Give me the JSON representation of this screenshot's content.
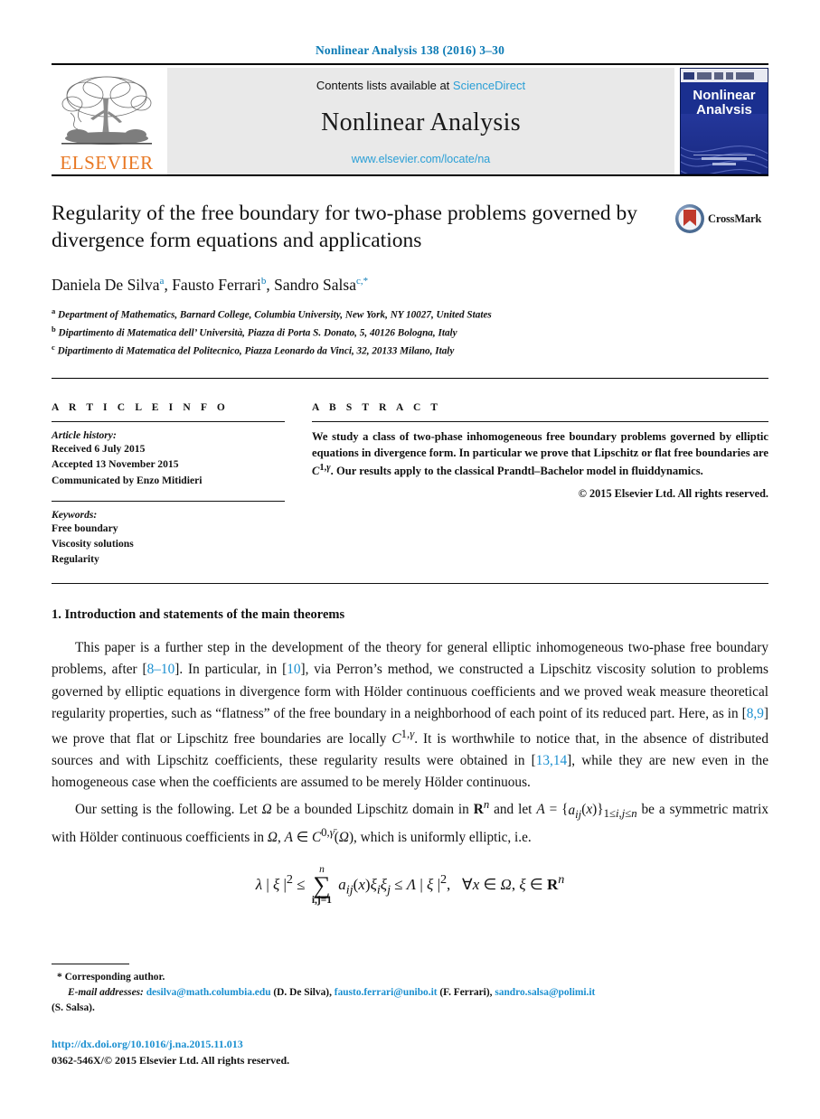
{
  "running_head": "Nonlinear Analysis 138 (2016) 3–30",
  "masthead": {
    "contents_prefix": "Contents lists available at ",
    "sciencedirect": "ScienceDirect",
    "journal_name": "Nonlinear Analysis",
    "journal_url": "www.elsevier.com/locate/na",
    "publisher_word": "ELSEVIER",
    "cover_title_line1": "Nonlinear",
    "cover_title_line2": "Analysis"
  },
  "article": {
    "title": "Regularity of the free boundary for two-phase problems governed by divergence form equations and applications",
    "crossmark_label": "CrossMark",
    "authors_html": "Daniela De Silva<sup>a</sup>, Fausto Ferrari<sup>b</sup>, Sandro Salsa<sup>c,*</sup>",
    "affiliations": [
      {
        "marker": "a",
        "text": "Department of Mathematics, Barnard College, Columbia University, New York, NY 10027, United States"
      },
      {
        "marker": "b",
        "text": "Dipartimento di Matematica dell’ Università, Piazza di Porta S. Donato, 5, 40126 Bologna, Italy"
      },
      {
        "marker": "c",
        "text": "Dipartimento di Matematica del Politecnico, Piazza Leonardo da Vinci, 32, 20133 Milano, Italy"
      }
    ]
  },
  "article_info": {
    "heading": "A R T I C L E    I N F O",
    "history_label": "Article history:",
    "history": [
      "Received 6 July 2015",
      "Accepted 13 November 2015",
      "Communicated by Enzo Mitidieri"
    ],
    "keywords_label": "Keywords:",
    "keywords": [
      "Free boundary",
      "Viscosity solutions",
      "Regularity"
    ]
  },
  "abstract": {
    "heading": "A B S T R A C T",
    "text": "We study a class of two-phase inhomogeneous free boundary problems governed by elliptic equations in divergence form. In particular we prove that Lipschitz or flat free boundaries are C1,γ. Our results apply to the classical Prandtl–Bachelor model in fluiddynamics.",
    "copyright": "© 2015 Elsevier Ltd. All rights reserved."
  },
  "body": {
    "section_heading": "1. Introduction and statements of the main theorems",
    "paragraph1_parts": {
      "p1": "This paper is a further step in the development of the theory for general elliptic inhomogeneous two-phase free boundary problems, after ",
      "ref1": "8–10",
      "p2": ". In particular, in ",
      "ref2": "10",
      "p3": ", via Perron’s method, we constructed a Lipschitz viscosity solution to problems governed by elliptic equations in divergence form with Hölder continuous coefficients and we proved weak measure theoretical regularity properties, such as “flatness” of the free boundary in a neighborhood of each point of its reduced part. Here, as in ",
      "ref3": "8,9",
      "p4": " we prove that flat or Lipschitz free boundaries are locally C1,γ. It is worthwhile to notice that, in the absence of distributed sources and with Lipschitz coefficients, these regularity results were obtained in ",
      "ref4": "13,14",
      "p5": ", while they are new even in the homogeneous case when the coefficients are assumed to be merely Hölder continuous."
    },
    "paragraph2_parts": {
      "p1": "Our setting is the following. Let Ω be a bounded Lipschitz domain in R",
      "sup1": "n",
      "p2": " and let A = {a",
      "sub1": "ij",
      "p3": "(x)}",
      "sub2": "1≤i,j≤n",
      "p4": " be a symmetric matrix with Hölder continuous coefficients in Ω, A ∈ C",
      "sup2": "0,γ̄",
      "p5": "(Ω), which is uniformly elliptic, i.e."
    },
    "equation": {
      "lhs": "λ | ξ |",
      "lhs_sup": "2",
      "le1": "≤",
      "sum_top": "n",
      "sum_symbol": "∑",
      "sum_bottom": "i,j=1",
      "summand": "a",
      "summand_sub": "ij",
      "summand_rest": "(x)ξ",
      "xi_i": "i",
      "xi_j_base": "ξ",
      "xi_j": "j",
      "le2": "≤",
      "rhs": "Λ | ξ |",
      "rhs_sup": "2",
      "comma": ",",
      "quantifier": "∀x ∈ Ω, ξ ∈ R",
      "quantifier_sup": "n"
    }
  },
  "footnotes": {
    "corresponding": "Corresponding author.",
    "corresponding_marker": "*",
    "email_label": "E-mail addresses:",
    "emails": [
      {
        "address": "desilva@math.columbia.edu",
        "person": "(D. De Silva)"
      },
      {
        "address": "fausto.ferrari@unibo.it",
        "person": "(F. Ferrari)"
      },
      {
        "address": "sandro.salsa@polimi.it",
        "person": "(S. Salsa)."
      }
    ],
    "doi": "http://dx.doi.org/10.1016/j.na.2015.11.013",
    "issn": "0362-546X/© 2015 Elsevier Ltd. All rights reserved."
  },
  "colors": {
    "link_blue": "#1a8fd0",
    "header_blue": "#0b7ab5",
    "elsevier_orange": "#e87722",
    "cover_blue": "#1a2f8f"
  }
}
